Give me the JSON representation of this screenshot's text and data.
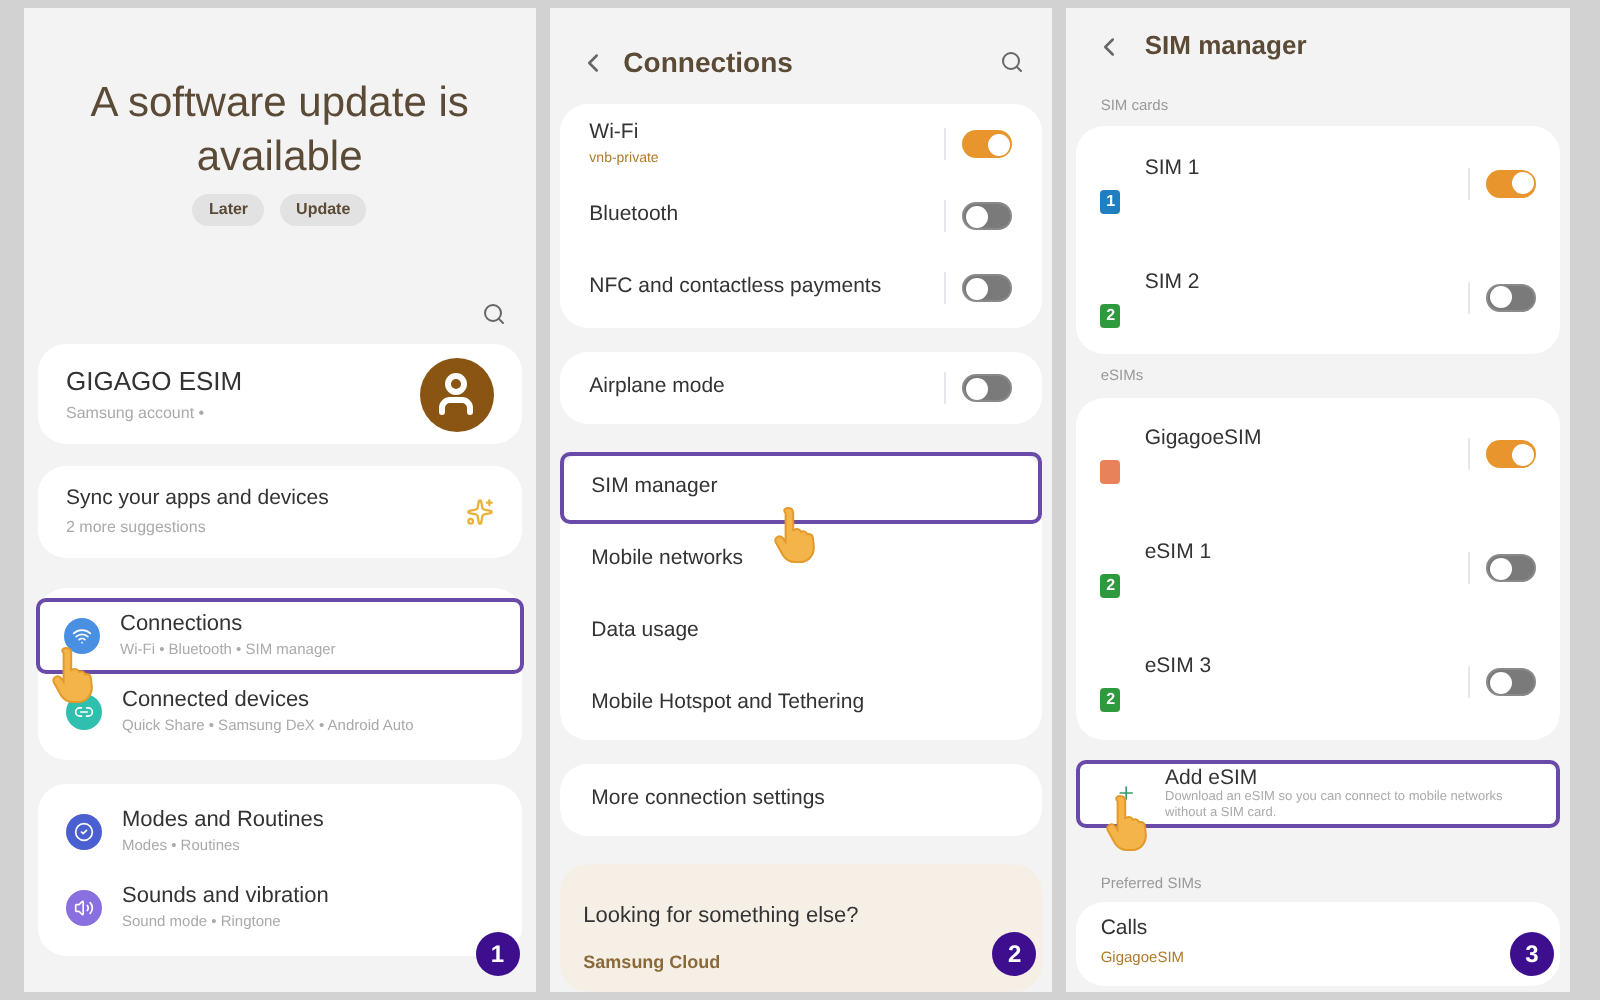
{
  "screen_1": {
    "banner": {
      "title": "A software update is available",
      "buttons": [
        "Later",
        "Update"
      ]
    },
    "account": {
      "name": "GIGAGO ESIM",
      "subtitle": "Samsung account  •"
    },
    "suggestion": {
      "title": "Sync your apps and devices",
      "subtitle": "2 more suggestions"
    },
    "groups": [
      [
        {
          "title": "Connections",
          "subtitle": "Wi-Fi  •  Bluetooth  •  SIM manager",
          "color": "#4a90e2",
          "selected": true
        },
        {
          "title": "Connected devices",
          "subtitle": "Quick Share  •  Samsung DeX  •  Android Auto",
          "color": "#2fbfae",
          "selected": false
        }
      ],
      [
        {
          "title": "Modes and Routines",
          "subtitle": "Modes  •  Routines",
          "color": "#4a5fd0",
          "selected": false
        },
        {
          "title": "Sounds and vibration",
          "subtitle": "Sound mode  •  Ringtone",
          "color": "#8a6fe0",
          "selected": false
        }
      ]
    ],
    "step": "1"
  },
  "screen_2": {
    "title": "Connections",
    "groups": [
      [
        {
          "kind": "toggle",
          "label": "Wi-Fi",
          "subtitle": "vnb-private",
          "on": true
        },
        {
          "kind": "toggle",
          "label": "Bluetooth",
          "on": false
        },
        {
          "kind": "toggle",
          "label": "NFC and contactless payments",
          "on": false
        }
      ],
      [
        {
          "kind": "toggle",
          "label": "Airplane mode",
          "on": false
        }
      ],
      [
        {
          "kind": "link",
          "label": "SIM manager",
          "selected": true
        },
        {
          "kind": "link",
          "label": "Mobile networks",
          "selected": false
        },
        {
          "kind": "link",
          "label": "Data usage",
          "selected": false
        },
        {
          "kind": "link",
          "label": "Mobile Hotspot and Tethering",
          "selected": false
        }
      ],
      [
        {
          "kind": "link",
          "label": "More connection settings",
          "selected": false
        }
      ]
    ],
    "footer": {
      "title": "Looking for something else?",
      "link": "Samsung Cloud"
    },
    "step": "2"
  },
  "screen_3": {
    "title": "SIM manager",
    "sections": [
      {
        "heading": "SIM cards",
        "rows": [
          {
            "label": "SIM 1",
            "badge": "1",
            "color": "#1f7fc0",
            "on": true
          },
          {
            "label": "SIM 2",
            "badge": "2",
            "color": "#2e9a3e",
            "on": false
          }
        ]
      },
      {
        "heading": "eSIMs",
        "rows": [
          {
            "label": "GigagoeSIM",
            "color": "#e8825a",
            "on": true
          },
          {
            "label": "eSIM 1",
            "badge": "2",
            "color": "#2e9a3e",
            "on": false
          },
          {
            "label": "eSIM 3",
            "badge": "2",
            "color": "#2e9a3e",
            "on": false
          }
        ]
      }
    ],
    "add": {
      "title": "Add eSIM",
      "subtitle": "Download an eSIM so you can connect to mobile networks without a SIM card.",
      "selected": true
    },
    "preferred": {
      "heading": "Preferred SIMs",
      "rows": [
        {
          "label": "Calls",
          "value": "GigagoeSIM"
        }
      ]
    },
    "step": "3"
  }
}
